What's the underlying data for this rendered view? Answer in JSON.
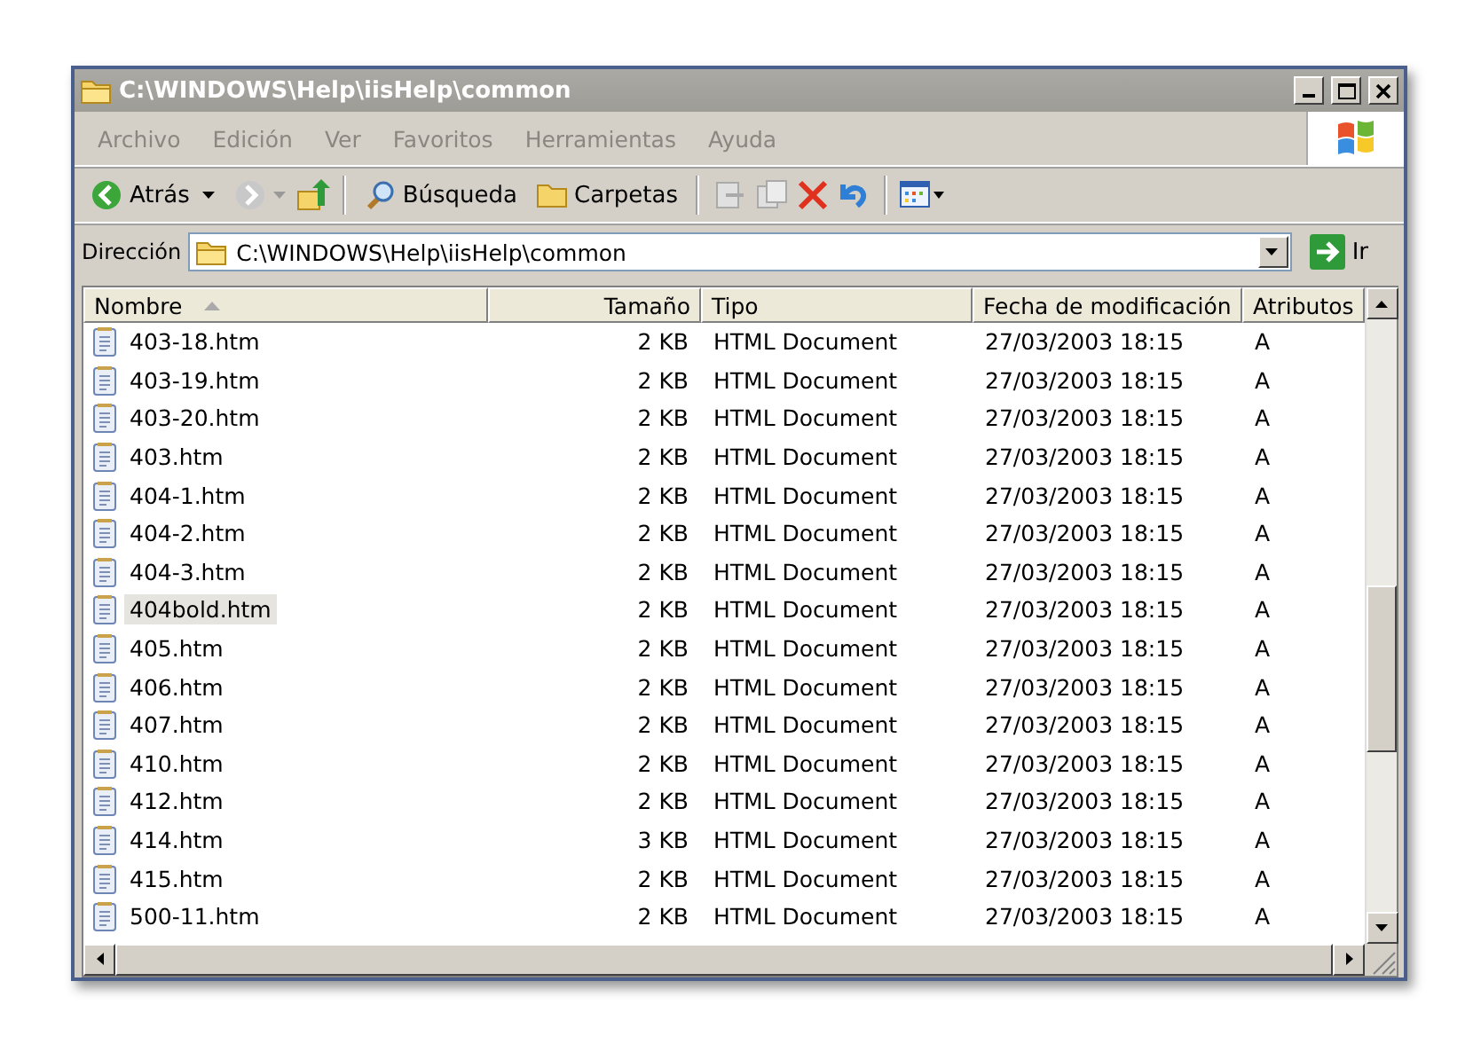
{
  "window": {
    "title": "C:\\WINDOWS\\Help\\iisHelp\\common"
  },
  "menu": [
    {
      "label": "Archivo"
    },
    {
      "label": "Edición"
    },
    {
      "label": "Ver"
    },
    {
      "label": "Favoritos"
    },
    {
      "label": "Herramientas"
    },
    {
      "label": "Ayuda"
    }
  ],
  "toolbar": {
    "back": "Atrás",
    "search": "Búsqueda",
    "folders": "Carpetas"
  },
  "address": {
    "label": "Dirección",
    "value": "C:\\WINDOWS\\Help\\iisHelp\\common",
    "go": "Ir"
  },
  "columns": [
    {
      "label": "Nombre",
      "sorted": true
    },
    {
      "label": "Tamaño",
      "sorted": false
    },
    {
      "label": "Tipo",
      "sorted": false
    },
    {
      "label": "Fecha de modificación",
      "sorted": false
    },
    {
      "label": "Atributos",
      "sorted": false
    }
  ],
  "rows": [
    {
      "name": "403-18.htm",
      "size": "2 KB",
      "type": "HTML Document",
      "modified": "27/03/2003 18:15",
      "attributes": "A",
      "selected": false
    },
    {
      "name": "403-19.htm",
      "size": "2 KB",
      "type": "HTML Document",
      "modified": "27/03/2003 18:15",
      "attributes": "A",
      "selected": false
    },
    {
      "name": "403-20.htm",
      "size": "2 KB",
      "type": "HTML Document",
      "modified": "27/03/2003 18:15",
      "attributes": "A",
      "selected": false
    },
    {
      "name": "403.htm",
      "size": "2 KB",
      "type": "HTML Document",
      "modified": "27/03/2003 18:15",
      "attributes": "A",
      "selected": false
    },
    {
      "name": "404-1.htm",
      "size": "2 KB",
      "type": "HTML Document",
      "modified": "27/03/2003 18:15",
      "attributes": "A",
      "selected": false
    },
    {
      "name": "404-2.htm",
      "size": "2 KB",
      "type": "HTML Document",
      "modified": "27/03/2003 18:15",
      "attributes": "A",
      "selected": false
    },
    {
      "name": "404-3.htm",
      "size": "2 KB",
      "type": "HTML Document",
      "modified": "27/03/2003 18:15",
      "attributes": "A",
      "selected": false
    },
    {
      "name": "404bold.htm",
      "size": "2 KB",
      "type": "HTML Document",
      "modified": "27/03/2003 18:15",
      "attributes": "A",
      "selected": true
    },
    {
      "name": "405.htm",
      "size": "2 KB",
      "type": "HTML Document",
      "modified": "27/03/2003 18:15",
      "attributes": "A",
      "selected": false
    },
    {
      "name": "406.htm",
      "size": "2 KB",
      "type": "HTML Document",
      "modified": "27/03/2003 18:15",
      "attributes": "A",
      "selected": false
    },
    {
      "name": "407.htm",
      "size": "2 KB",
      "type": "HTML Document",
      "modified": "27/03/2003 18:15",
      "attributes": "A",
      "selected": false
    },
    {
      "name": "410.htm",
      "size": "2 KB",
      "type": "HTML Document",
      "modified": "27/03/2003 18:15",
      "attributes": "A",
      "selected": false
    },
    {
      "name": "412.htm",
      "size": "2 KB",
      "type": "HTML Document",
      "modified": "27/03/2003 18:15",
      "attributes": "A",
      "selected": false
    },
    {
      "name": "414.htm",
      "size": "3 KB",
      "type": "HTML Document",
      "modified": "27/03/2003 18:15",
      "attributes": "A",
      "selected": false
    },
    {
      "name": "415.htm",
      "size": "2 KB",
      "type": "HTML Document",
      "modified": "27/03/2003 18:15",
      "attributes": "A",
      "selected": false
    },
    {
      "name": "500-11.htm",
      "size": "2 KB",
      "type": "HTML Document",
      "modified": "27/03/2003 18:15",
      "attributes": "A",
      "selected": false
    }
  ]
}
